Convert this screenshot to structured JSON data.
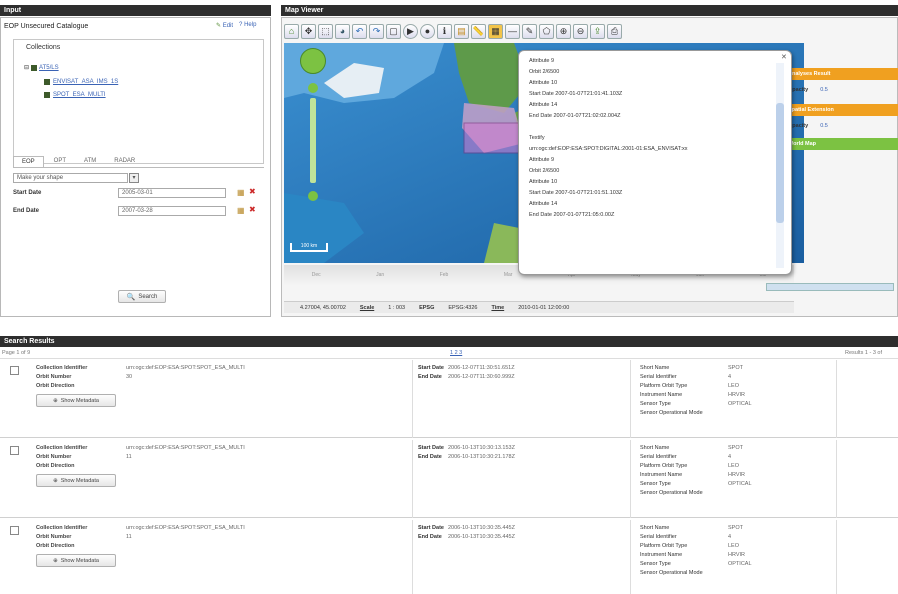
{
  "input": {
    "title": "Input",
    "catalogue": "EOP Unsecured Catalogue",
    "edit": "Edit",
    "help": "Help",
    "collections_label": "Collections",
    "tree": {
      "root": "AT5/LS",
      "items": [
        "ENVISAT_ASA_IMS_1S",
        "SPOT_ESA_MULTI"
      ]
    },
    "tabs": [
      "EOP",
      "OPT",
      "ATM",
      "RADAR"
    ],
    "shape_select": "Make your shape",
    "start_label": "Start Date",
    "start_value": "2005-03-01",
    "end_label": "End Date",
    "end_value": "2007-03-28",
    "search_button": "Search"
  },
  "map": {
    "title": "Map Viewer",
    "popup": {
      "lines": [
        "Attribute 9",
        "Orbit 2/6500",
        "Attribute 10",
        "Start Date 2007-01-07T21:01:41.103Z",
        "Attribute 14",
        "End Date 2007-01-07T21:02:02.004Z",
        "",
        "Textify",
        "urn:ogc:def:EOP:ESA:SPOT:DIGITAL:2001-01:ESA_ENVISAT:xx",
        "Attribute 9",
        "Orbit 2/6500",
        "Attribute 10",
        "Start Date 2007-01-07T21:01:51.103Z",
        "Attribute 14",
        "End Date 2007-01-07T21:05:0.00Z"
      ]
    },
    "status": {
      "coords": "4.27004, 45.00702",
      "scale_label": "Scale",
      "scale_value": "1 : 003",
      "epsg_label": "EPSG",
      "epsg_value": "EPSG:4326",
      "time_label": "Time",
      "time_value": "2010-01-01 12:00:00"
    },
    "ruler": "100 km",
    "layers": [
      {
        "title": "Analyses Result",
        "opacity_label": "Opacity",
        "opacity": "0.5"
      },
      {
        "title": "Spatial Extension",
        "opacity_label": "Opacity",
        "opacity": "0.5"
      },
      {
        "title": "World Map"
      }
    ],
    "timeline_ticks": [
      "Dec",
      "Jan",
      "Feb",
      "Mar",
      "Apr",
      "May",
      "Jun",
      "Jul"
    ]
  },
  "results": {
    "title": "Search Results",
    "page": "Page 1 of 9",
    "pager": "1 2 3",
    "count": "Results 1 - 3 of",
    "rows": [
      {
        "collection": "urn:ogc:def:EOP:ESA:SPOT:SPOT_ESA_MULTI",
        "orbit_number": "30",
        "start": "2006-12-07T11:30:51.651Z",
        "end": "2006-12-07T11:30:60.999Z",
        "short_name": "SPOT",
        "serial": "4",
        "orbit_type": "LEO",
        "instrument": "HRVIR",
        "sensor_type": "OPTICAL"
      },
      {
        "collection": "urn:ogc:def:EOP:ESA:SPOT:SPOT_ESA_MULTI",
        "orbit_number": "11",
        "start": "2006-10-13T10:30:13.153Z",
        "end": "2006-10-13T10:30:21.178Z",
        "short_name": "SPOT",
        "serial": "4",
        "orbit_type": "LEO",
        "instrument": "HRVIR",
        "sensor_type": "OPTICAL"
      },
      {
        "collection": "urn:ogc:def:EOP:ESA:SPOT:SPOT_ESA_MULTI",
        "orbit_number": "11",
        "start": "2006-10-13T10:30:35.445Z",
        "end": "2006-10-13T10:30:35.445Z",
        "short_name": "SPOT",
        "serial": "4",
        "orbit_type": "LEO",
        "instrument": "HRVIR",
        "sensor_type": "OPTICAL"
      }
    ],
    "labels": {
      "collection": "Collection Identifier",
      "orbit_number": "Orbit Number",
      "orbit_direction": "Orbit Direction",
      "show_metadata": "Show Metadata",
      "start": "Start Date",
      "end": "End Date",
      "short_name": "Short Name",
      "serial": "Serial Identifier",
      "orbit_type": "Platform Orbit Type",
      "instrument": "Instrument Name",
      "sensor_type": "Sensor Type",
      "sensor_mode": "Sensor Operational Mode"
    }
  }
}
